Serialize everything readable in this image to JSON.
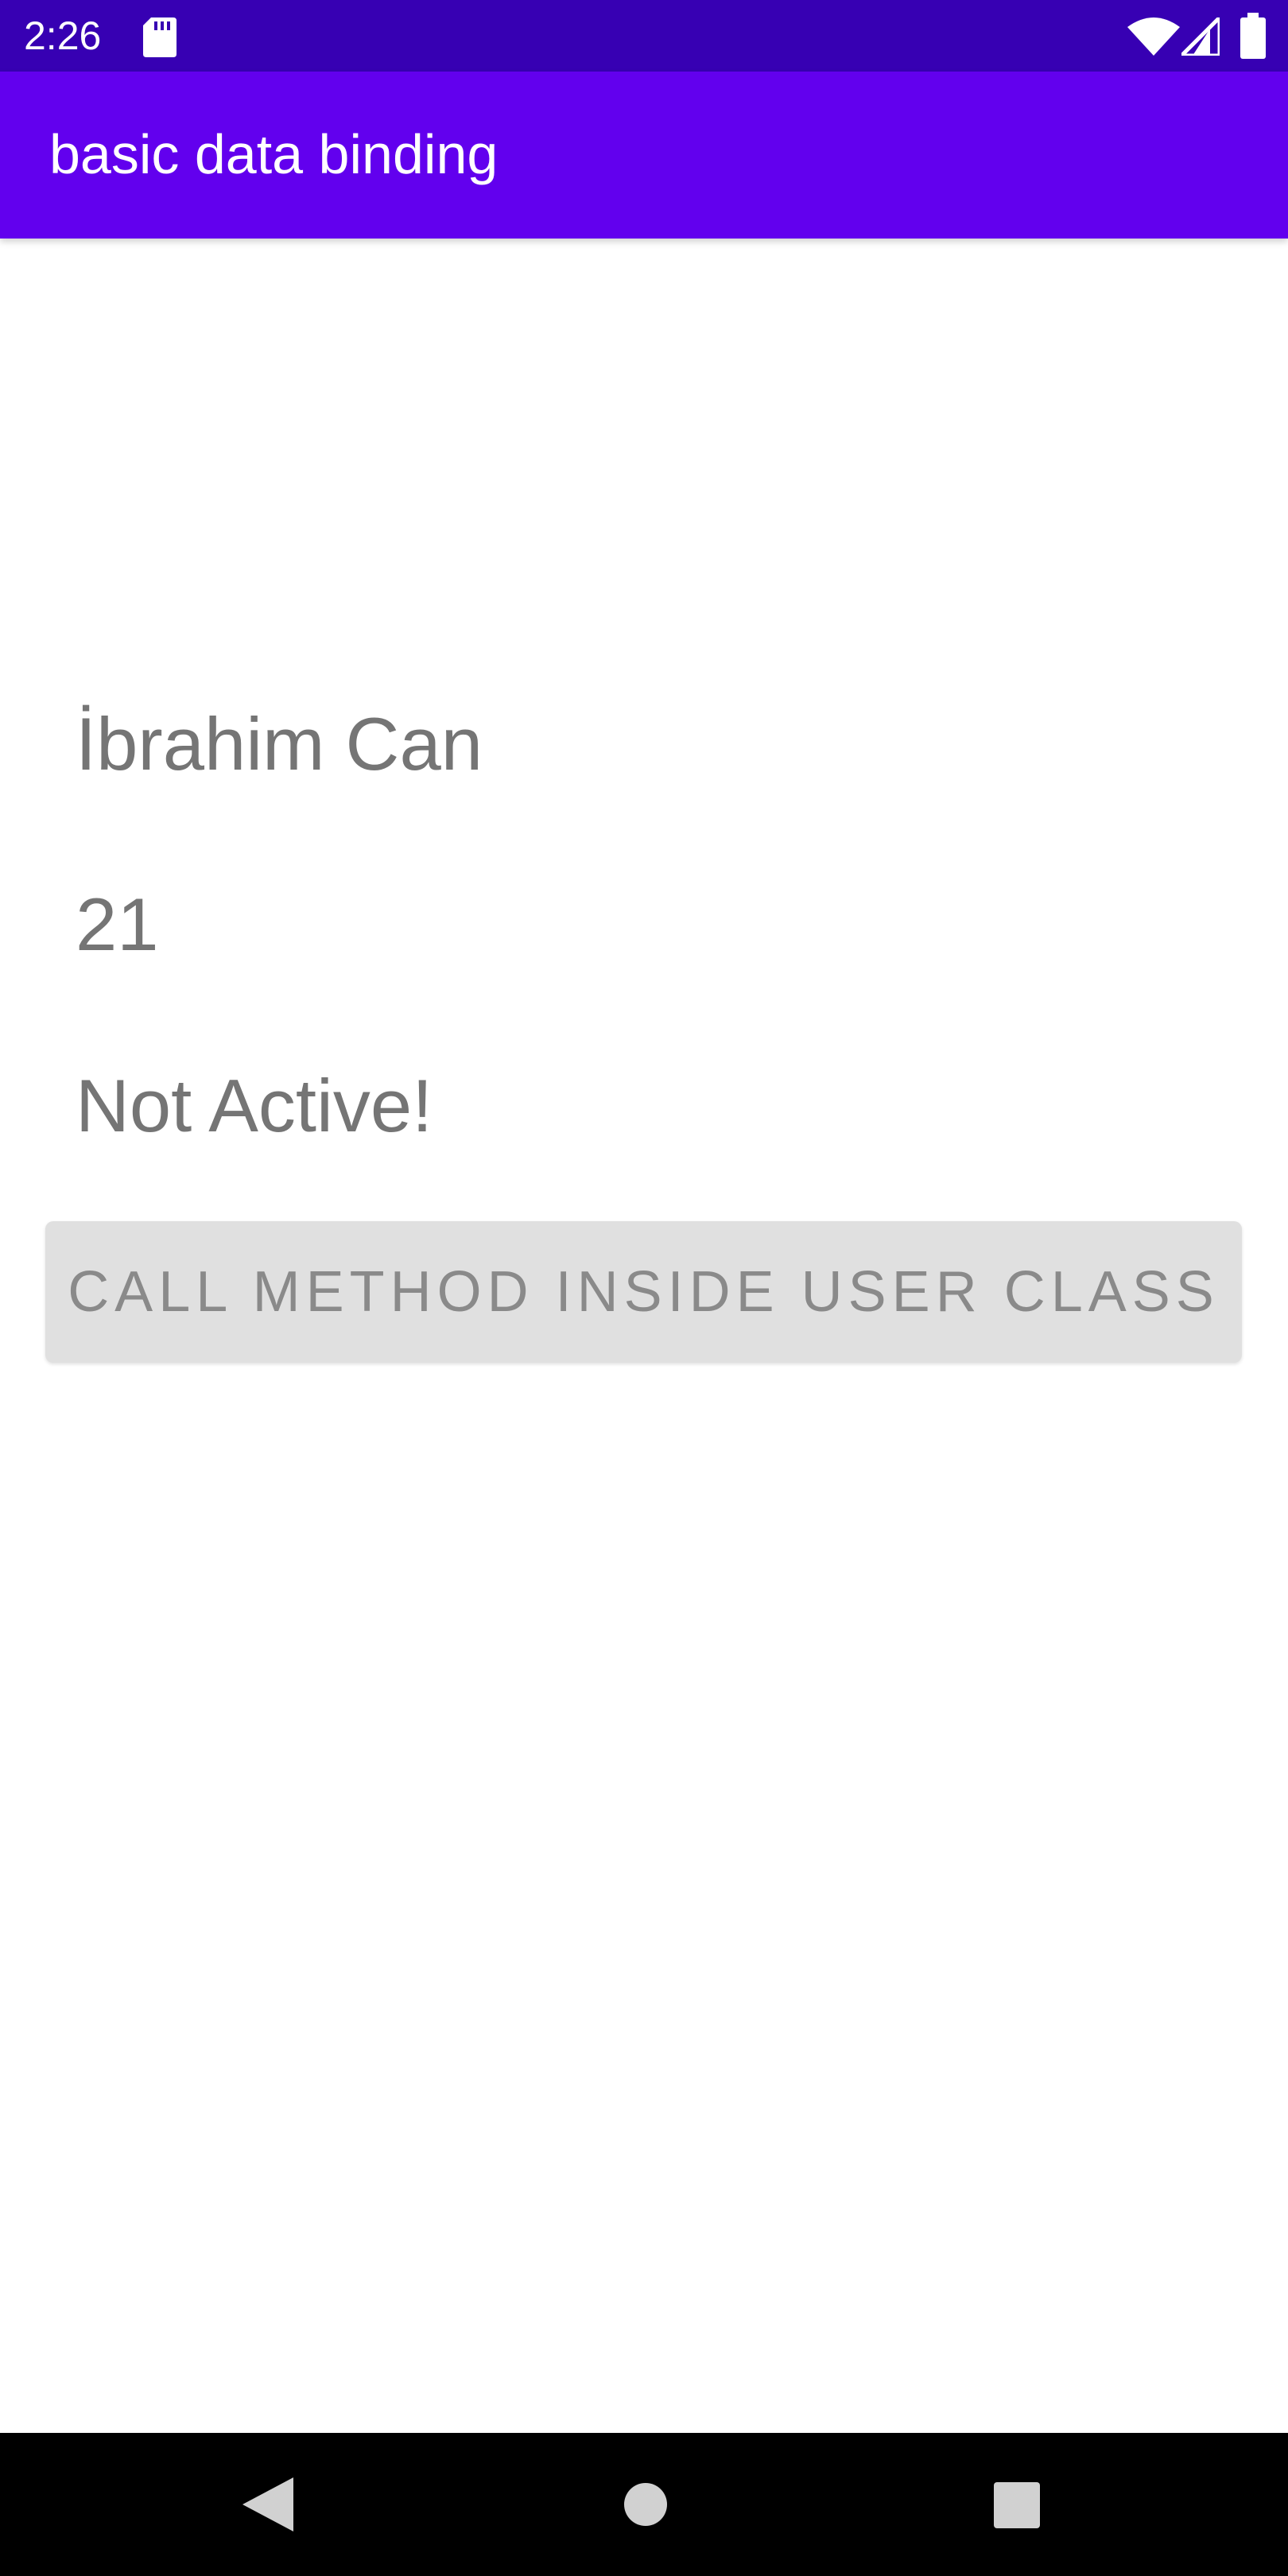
{
  "status_bar": {
    "time": "2:26",
    "icons": [
      "sd-card-icon",
      "wifi-icon",
      "signal-icon",
      "battery-icon"
    ],
    "background_color": "#3700B3"
  },
  "app_bar": {
    "title": "basic data binding",
    "background_color": "#6200EE"
  },
  "content": {
    "name": "İbrahim Can",
    "age": "21",
    "status": "Not Active!",
    "button_label": "CALL METHOD INSIDE USER CLASS"
  },
  "nav_bar": {
    "icons": [
      "back-icon",
      "home-icon",
      "recents-icon"
    ]
  }
}
